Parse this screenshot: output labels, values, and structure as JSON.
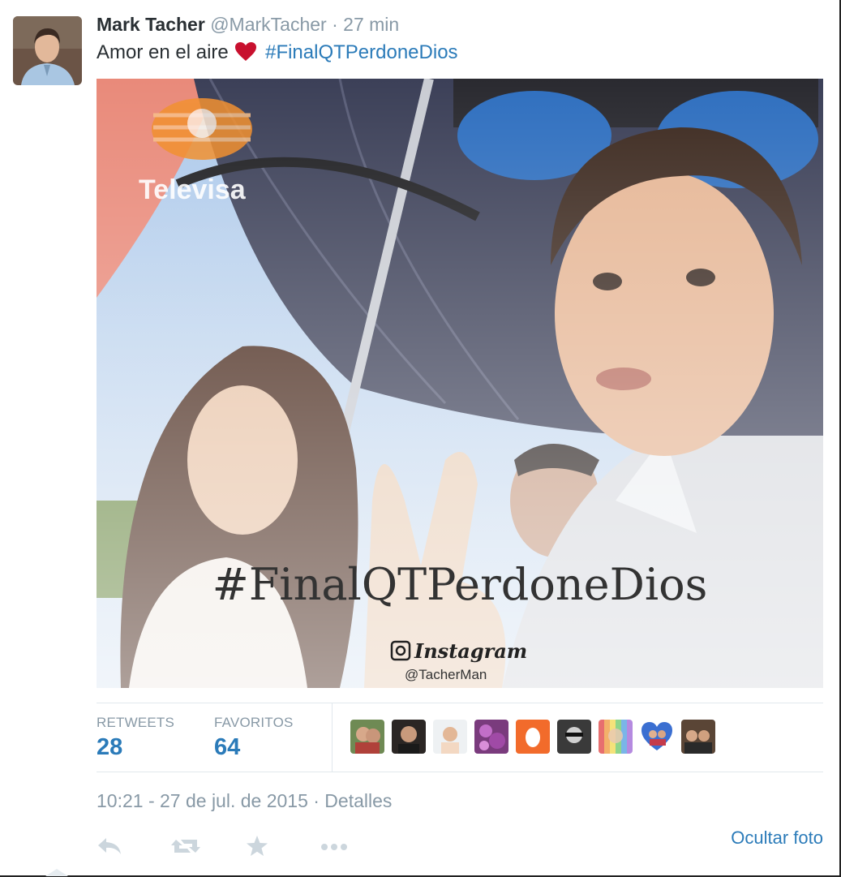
{
  "tweet": {
    "author_name": "Mark Tacher",
    "author_handle": "@MarkTacher",
    "separator": "·",
    "time_ago": "27 min",
    "text": "Amor en el aire",
    "hashtag": "#FinalQTPerdoneDios"
  },
  "photo": {
    "watermark": "Televisa",
    "overlay_hashtag": "#FinalQTPerdoneDios",
    "instagram_label": "Instagram",
    "instagram_handle": "@TacherMan"
  },
  "stats": {
    "retweets_label": "RETWEETS",
    "retweets_value": "28",
    "favorites_label": "FAVORITOS",
    "favorites_value": "64"
  },
  "timestamp": "10:21 - 27 de jul. de 2015 · Detalles",
  "actions": {
    "reply_icon": "reply-icon",
    "retweet_icon": "retweet-icon",
    "favorite_icon": "star-icon",
    "more_icon": "more-icon",
    "hide_photo": "Ocultar foto"
  },
  "colors": {
    "link": "#2b7bb9",
    "muted": "#8899a6",
    "text": "#292f33",
    "heart": "#c8102e"
  }
}
